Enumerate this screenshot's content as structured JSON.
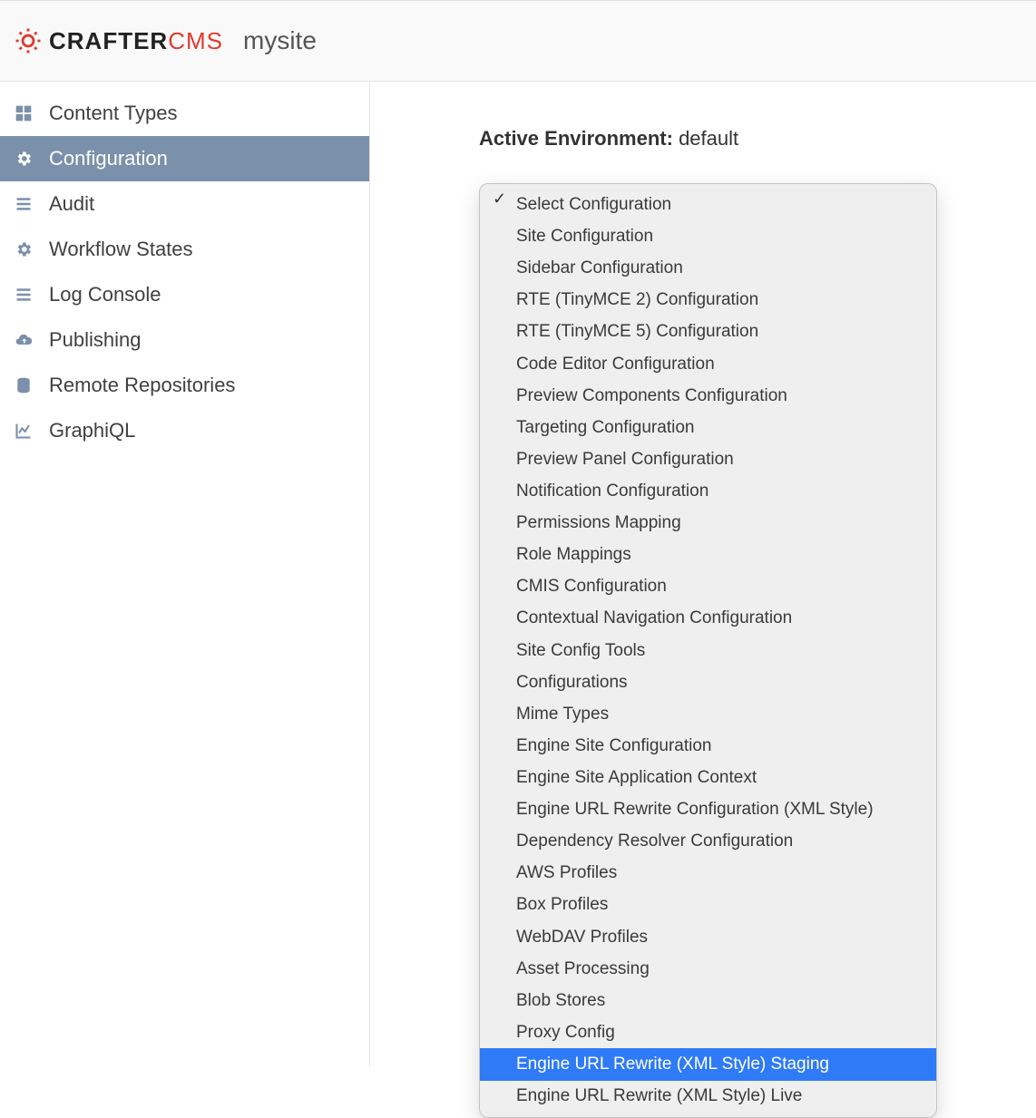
{
  "header": {
    "brand_primary": "CRAFTER",
    "brand_secondary": "CMS",
    "site_name": "mysite"
  },
  "sidebar": {
    "items": [
      {
        "label": "Content Types",
        "icon": "grid-icon"
      },
      {
        "label": "Configuration",
        "icon": "gear-icon"
      },
      {
        "label": "Audit",
        "icon": "list-icon"
      },
      {
        "label": "Workflow States",
        "icon": "gear-icon"
      },
      {
        "label": "Log Console",
        "icon": "list-icon"
      },
      {
        "label": "Publishing",
        "icon": "cloud-up-icon"
      },
      {
        "label": "Remote Repositories",
        "icon": "database-icon"
      },
      {
        "label": "GraphiQL",
        "icon": "chart-icon"
      }
    ],
    "active_index": 1
  },
  "content": {
    "env_label_bold": "Active Environment:",
    "env_value": "default"
  },
  "dropdown": {
    "selected_index": 0,
    "highlighted_index": 27,
    "options": [
      "Select Configuration",
      "Site Configuration",
      "Sidebar Configuration",
      "RTE (TinyMCE 2) Configuration",
      "RTE (TinyMCE 5) Configuration",
      "Code Editor Configuration",
      "Preview Components Configuration",
      "Targeting Configuration",
      "Preview Panel Configuration",
      "Notification Configuration",
      "Permissions Mapping",
      "Role Mappings",
      "CMIS Configuration",
      "Contextual Navigation Configuration",
      "Site Config Tools",
      "Configurations",
      "Mime Types",
      "Engine Site Configuration",
      "Engine Site Application Context",
      "Engine URL Rewrite Configuration (XML Style)",
      "Dependency Resolver Configuration",
      "AWS Profiles",
      "Box Profiles",
      "WebDAV Profiles",
      "Asset Processing",
      "Blob Stores",
      "Proxy Config",
      "Engine URL Rewrite (XML Style) Staging",
      "Engine URL Rewrite (XML Style) Live"
    ]
  },
  "colors": {
    "brand_red": "#e03b2f",
    "sidebar_active": "#7b90aa",
    "highlight_blue": "#2f7af6"
  }
}
